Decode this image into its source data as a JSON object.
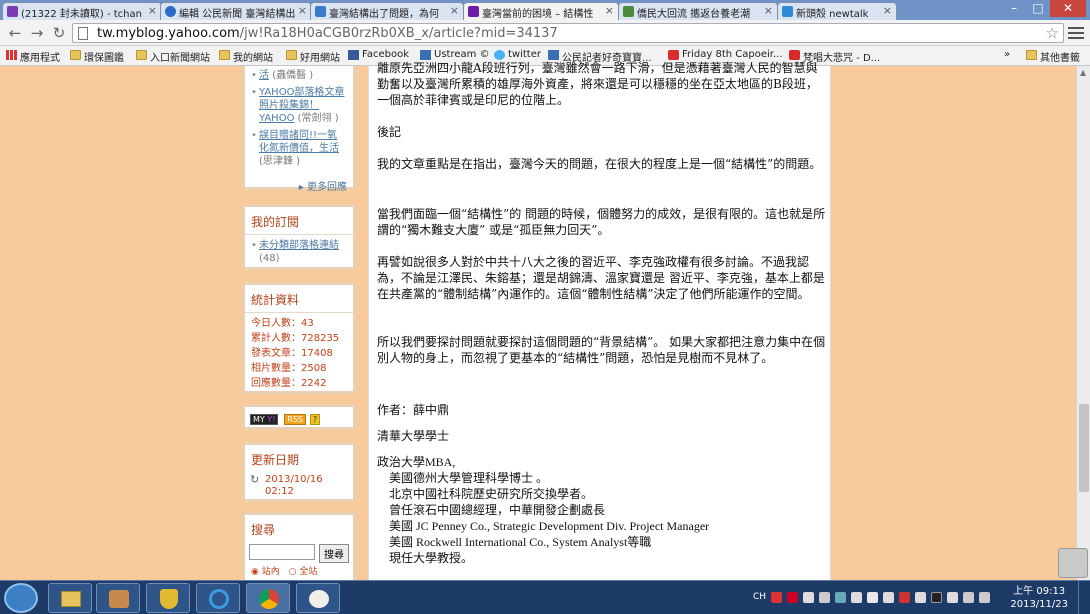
{
  "browser": {
    "tabs": [
      {
        "title": "(21322 封未讀取) - tchan",
        "icon": "mail-icon",
        "color": "#7a3db4"
      },
      {
        "title": "編輯 公民新聞 臺灣結構出",
        "icon": "globe-icon",
        "color": "#2b6cc4"
      },
      {
        "title": "臺灣結構出了問題，為何",
        "icon": "p-icon",
        "color": "#3b7bc8"
      },
      {
        "title": "臺灣當前的困境 – 結構性",
        "icon": "yahoo-icon",
        "color": "#6d1ea8"
      },
      {
        "title": "僑民大回流 攜返台養老潮",
        "icon": "m-icon",
        "color": "#4a8a3a"
      },
      {
        "title": "新頭殼 newtalk",
        "icon": "newtalk-icon",
        "color": "#2e8bd8"
      }
    ],
    "url_host": "tw.myblog.yahoo.com",
    "url_path": "/jw!Ra18H0aCGB0rzRb0XB_x/article?mid=34137",
    "bookmarks": [
      {
        "label": "應用程式",
        "icon": "apps-icon"
      },
      {
        "label": "環保圖鑑",
        "icon": "folder-icon"
      },
      {
        "label": "入口新聞網站",
        "icon": "folder-icon"
      },
      {
        "label": "我的網站",
        "icon": "folder-icon"
      },
      {
        "label": "好用網站",
        "icon": "folder-icon"
      },
      {
        "label": "Facebook",
        "icon": "facebook-icon"
      },
      {
        "label": "Ustream ©",
        "icon": "ustream-icon"
      },
      {
        "label": "twitter",
        "icon": "twitter-icon"
      },
      {
        "label": "公民記者好奇寶寶...",
        "icon": "ustream-icon"
      },
      {
        "label": "Friday 8th Capoeir...",
        "icon": "youtube-icon"
      },
      {
        "label": "梵唱大悲咒 - D...",
        "icon": "youtube-icon"
      },
      {
        "label": "»",
        "icon": ""
      },
      {
        "label": "其他書籤",
        "icon": "folder-icon"
      }
    ]
  },
  "sidebar": {
    "recent_links": [
      {
        "prefix": "",
        "link": "活",
        "author": "(蟲僑醫 )"
      },
      {
        "prefix": "",
        "link": "YAHOO部落格文章照片殺集錦！YAHOO",
        "author": "(常劍翎 )"
      },
      {
        "prefix": "",
        "link": "誤目贈諸同!!一氧化氮新價值，生活",
        "author": "(思津鋒 )"
      }
    ],
    "more_label": "▸ 更多回應",
    "subscriptions_title": "我的訂閱",
    "subscriptions": [
      {
        "link": "未分類部落格連結",
        "count": "(48)"
      }
    ],
    "stats_title": "統計資料",
    "stats": [
      {
        "label": "今日人數：",
        "value": "43"
      },
      {
        "label": "累計人數：",
        "value": "728235"
      },
      {
        "label": "發表文章：",
        "value": "17408"
      },
      {
        "label": "相片數量：",
        "value": "2508"
      },
      {
        "label": "回應數量：",
        "value": "2242"
      }
    ],
    "badges": [
      "MY",
      "Y!",
      "RSS",
      "?"
    ],
    "updated_title": "更新日期",
    "updated_value": "2013/10/16 02:12",
    "search_title": "搜尋",
    "search_button": "搜尋",
    "search_scope_site": "站內",
    "search_scope_all": "全站"
  },
  "article": {
    "p1": "離原先亞洲四小龍A段班行列，臺灣雖然會一路下滑，但是憑藉著臺灣人民的智慧與勤奮以及臺灣所累積的雄厚海外資產，將來還是可以穩穩的坐在亞太地區的B段班，一個高於菲律賓或是印尼的位階上。",
    "p2": "後記",
    "p3": "我的文章重點是在指出，臺灣今天的問題，在很大的程度上是一個“結構性”的問題。",
    "p4": "當我們面臨一個“結構性”的 問題的時候，個體努力的成效，是很有限的。這也就是所謂的“獨木難支大廈” 或是“孤臣無力回天”。",
    "p5": "再譬如說很多人對於中共十八大之後的習近平、李克強政權有很多討論。不過我認為，不論是江澤民、朱鎔基；還是胡錦濤、溫家寶還是 習近平、李克強，基本上都是在共產黨的“體制結構”內運作的。這個“體制性結構”決定了他們所能運作的空間。",
    "p6": "所以我們要探討問題就要探討這個問題的“背景結構”。 如果大家都把注意力集中在個別人物的身上，而忽視了更基本的“結構性”問題，恐怕是見樹而不見林了。",
    "author": "作者：薛中鼎",
    "school": "清華大學學士",
    "cv": [
      "政治大學MBA,",
      "美國德州大學管理科學博士 。",
      "北京中國社科院歷史研究所交換學者。",
      "曾任滾石中國總經理，中華開發企劃處長",
      "美國 JC Penney Co., Strategic Development Div. Project Manager",
      "美國 Rockwell International Co., System Analyst等職",
      "現任大學教授。"
    ]
  },
  "taskbar": {
    "time": "上午 09:13",
    "date": "2013/11/23",
    "lang": "CH"
  }
}
